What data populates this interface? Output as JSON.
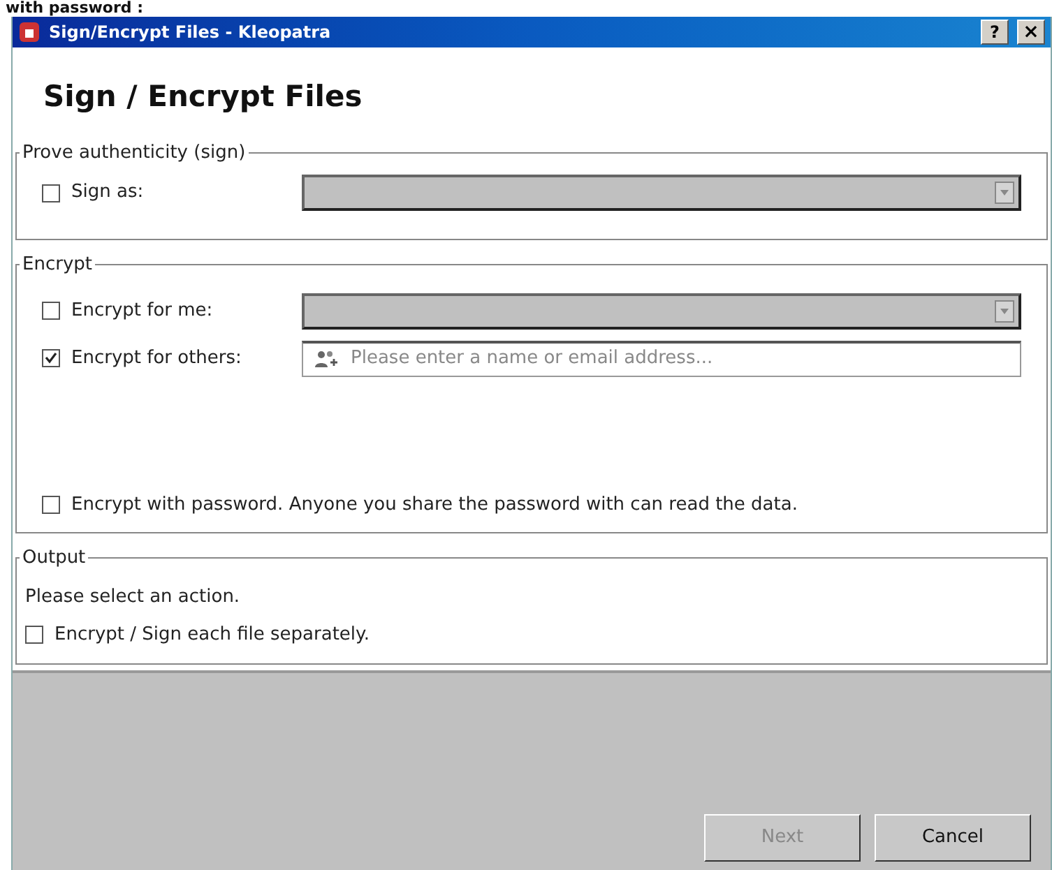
{
  "caption": "with password :",
  "window": {
    "title": "Sign/Encrypt Files - Kleopatra",
    "help": "?",
    "close": "×"
  },
  "heading": "Sign / Encrypt Files",
  "sign_group": {
    "legend": "Prove authenticity (sign)",
    "options": [
      {
        "label": "Sign as:",
        "checked": false,
        "kind": "combo",
        "field_disabled": true
      }
    ]
  },
  "encrypt_group": {
    "legend": "Encrypt",
    "options": [
      {
        "label": "Encrypt for me:",
        "checked": false,
        "kind": "combo",
        "field_disabled": true
      },
      {
        "label": "Encrypt for others:",
        "checked": true,
        "kind": "recipients",
        "placeholder": "Please enter a name or email address..."
      }
    ],
    "password": {
      "label": "Encrypt with password. Anyone you share the password with can read the data.",
      "checked": false
    }
  },
  "output_group": {
    "legend": "Output",
    "message": "Please select an action.",
    "separately": {
      "label": "Encrypt / Sign each file separately.",
      "checked": false
    }
  },
  "buttons": [
    {
      "label": "Next",
      "disabled": true
    },
    {
      "label": "Cancel",
      "disabled": false
    }
  ]
}
